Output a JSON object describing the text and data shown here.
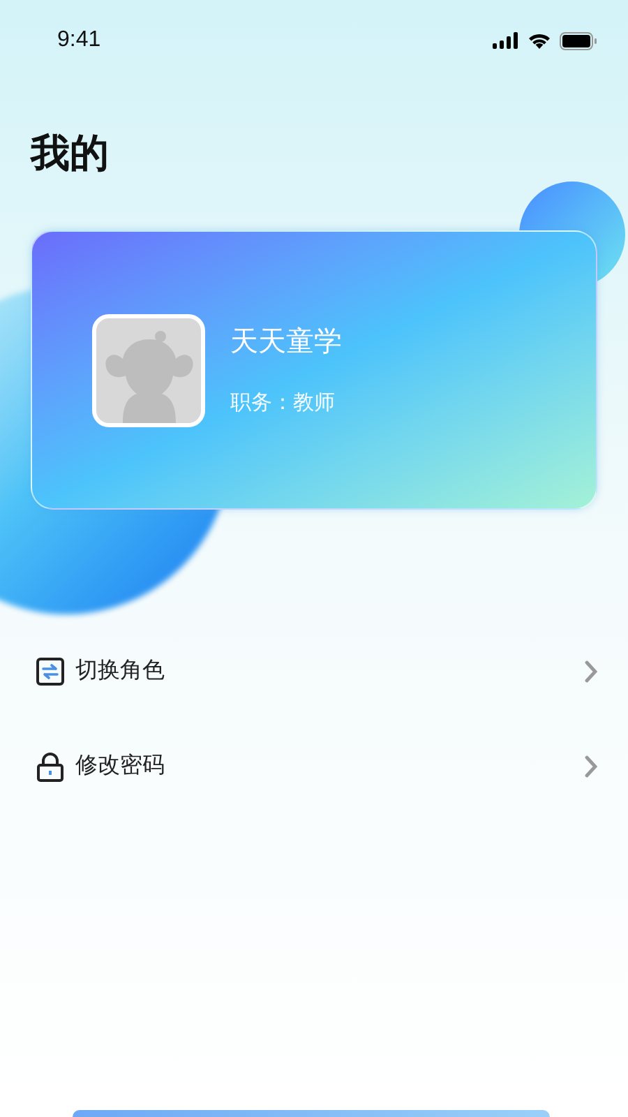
{
  "status_bar": {
    "time": "9:41"
  },
  "page_title": "我的",
  "profile": {
    "name": "天天童学",
    "role": "职务：教师"
  },
  "menu": [
    {
      "kind": "switch",
      "label": "切换角色"
    },
    {
      "kind": "lock",
      "label": "修改密码"
    }
  ]
}
